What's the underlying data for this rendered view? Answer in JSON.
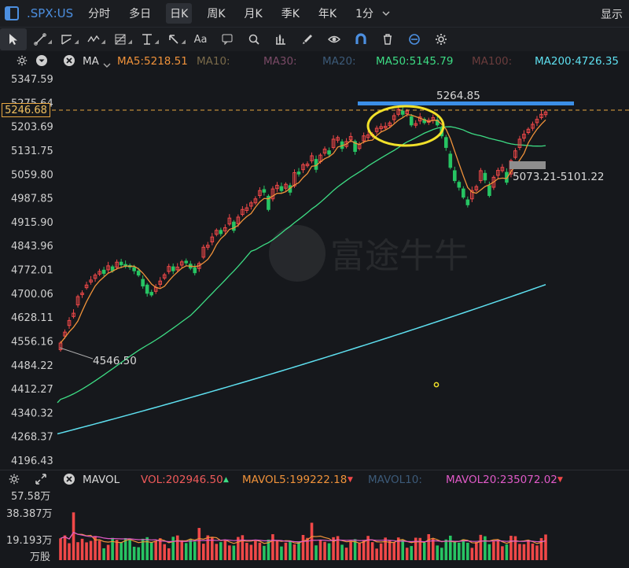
{
  "topbar": {
    "symbol": ".SPX:US",
    "periods": [
      "分时",
      "多日",
      "日K",
      "周K",
      "月K",
      "季K",
      "年K",
      "1分"
    ],
    "active_period": "日K",
    "dropdown_icon": "chevron-down-icon",
    "display_label": "显示"
  },
  "toolbar": {
    "icons": [
      "cursor-arrow-icon",
      "line-tool-icon",
      "polyline-tool-icon",
      "wave-tool-icon",
      "fib-grid-icon",
      "horizontal-line-icon",
      "arrow-tool-icon",
      "text-tool-icon",
      "comment-icon",
      "search-icon",
      "indicator-icon",
      "brush-icon",
      "visibility-eye-icon",
      "magnet-icon",
      "trash-icon",
      "sync-icon",
      "settings-gear-icon"
    ],
    "text_tool_label": "Aa"
  },
  "ma_legend": {
    "label": "MA",
    "items": [
      {
        "text": "MA5:5218.51",
        "color": "#f0923a"
      },
      {
        "text": "MA10:",
        "color": "#7a6a4a"
      },
      {
        "text": "MA30:",
        "color": "#7a4a66"
      },
      {
        "text": "MA20:",
        "color": "#3c5a78"
      },
      {
        "text": "MA50:5145.79",
        "color": "#3ddc84"
      },
      {
        "text": "MA100:",
        "color": "#6a3c3c"
      },
      {
        "text": "MA200:4726.35",
        "color": "#5ee0f0"
      }
    ]
  },
  "price_axis": {
    "ticks": [
      "5347.59",
      "5275.64",
      "5203.69",
      "5131.75",
      "5059.80",
      "4987.85",
      "4915.90",
      "4843.96",
      "4772.01",
      "4700.06",
      "4628.11",
      "4556.16",
      "4484.22",
      "4412.27",
      "4340.32",
      "4268.37",
      "4196.43"
    ],
    "current_price": "5246.68"
  },
  "annotations": {
    "high_label": "5264.85",
    "low_label": "4546.50",
    "gap_label": "5073.21-5101.22"
  },
  "watermark": "富途牛牛",
  "volume_legend": {
    "label": "MAVOL",
    "items": [
      {
        "text": "VOL:202946.50",
        "color": "#f05a5a",
        "arrow": "up"
      },
      {
        "text": "MAVOL5:199222.18",
        "color": "#f0923a",
        "arrow": "down"
      },
      {
        "text": "MAVOL10:",
        "color": "#3c5a78",
        "arrow": ""
      },
      {
        "text": "MAVOL20:235072.02",
        "color": "#e05ac8",
        "arrow": "down"
      }
    ]
  },
  "volume_axis": {
    "ticks": [
      "57.58万",
      "38.387万",
      "19.193万"
    ],
    "unit": "万股"
  },
  "colors": {
    "up": "#f04848",
    "down": "#27c463",
    "ma5": "#f0923a",
    "ma50": "#3ddc84",
    "ma200": "#5ee0f0",
    "accent": "#4c8fe0",
    "highlight_circle": "#f2e12a",
    "resistance_line": "#3b8fe8"
  },
  "chart_data": {
    "type": "candlestick",
    "yrange": [
      4196.43,
      5347.59
    ],
    "candles_close": [
      4550,
      4583,
      4618,
      4640,
      4690,
      4701,
      4725,
      4740,
      4755,
      4766,
      4760,
      4783,
      4768,
      4794,
      4786,
      4781,
      4779,
      4768,
      4755,
      4722,
      4700,
      4695,
      4718,
      4737,
      4756,
      4781,
      4768,
      4779,
      4795,
      4792,
      4776,
      4762,
      4790,
      4839,
      4845,
      4870,
      4890,
      4880,
      4898,
      4927,
      4890,
      4930,
      4953,
      4958,
      4973,
      4985,
      5010,
      5005,
      4953,
      5015,
      5026,
      5010,
      5029,
      5005,
      5064,
      5060,
      5088,
      5090,
      5115,
      5074,
      5117,
      5135,
      5120,
      5165,
      5170,
      5137,
      5158,
      5173,
      5128,
      5149,
      5175,
      5178,
      5180,
      5198,
      5203,
      5204,
      5214,
      5236,
      5255,
      5240,
      5250,
      5208,
      5212,
      5232,
      5215,
      5222,
      5230,
      5208,
      5175,
      5140,
      5080,
      5040,
      5020,
      4990,
      4967,
      5010,
      5022,
      5070,
      5042,
      4995,
      5050,
      5071,
      5080,
      5035,
      5100,
      5130,
      5165,
      5180,
      5195,
      5210,
      5225,
      5240,
      5247
    ],
    "candles_open_delta": [
      -20,
      -12,
      -15,
      -10,
      -25,
      -5,
      -8,
      -6,
      -10,
      -8,
      10,
      -12,
      12,
      -15,
      8,
      6,
      5,
      10,
      12,
      20,
      25,
      8,
      -12,
      -10,
      -10,
      -15,
      12,
      -8,
      -10,
      5,
      12,
      15,
      -15,
      -30,
      -6,
      -15,
      -12,
      10,
      -10,
      -18,
      25,
      -20,
      -15,
      -8,
      -10,
      -12,
      -15,
      8,
      40,
      -30,
      -10,
      12,
      -12,
      20,
      -40,
      6,
      -15,
      -5,
      -15,
      30,
      -20,
      -12,
      10,
      -25,
      -8,
      20,
      -15,
      -10,
      30,
      -12,
      -15,
      -8,
      -5,
      -10,
      -6,
      -5,
      -8,
      -12,
      -15,
      10,
      -8,
      25,
      -5,
      -12,
      10,
      -6,
      -8,
      15,
      25,
      30,
      40,
      30,
      15,
      25,
      15,
      -25,
      -10,
      -30,
      20,
      30,
      -30,
      -15,
      -10,
      30,
      -40,
      -20,
      -25,
      -12,
      -10,
      -12,
      -10,
      -10,
      -8
    ],
    "ma5_end": 5218.51,
    "ma50_end": 5145.79,
    "ma200_end": 4726.35,
    "high": 5264.85,
    "low": 4546.5,
    "gap": "5073.21-5101.22",
    "volume": {
      "axis_ticks": [
        "57.58万",
        "38.387万",
        "19.193万"
      ],
      "vol_last": 202946.5,
      "mavol5": 199222.18,
      "mavol20": 235072.02
    }
  }
}
